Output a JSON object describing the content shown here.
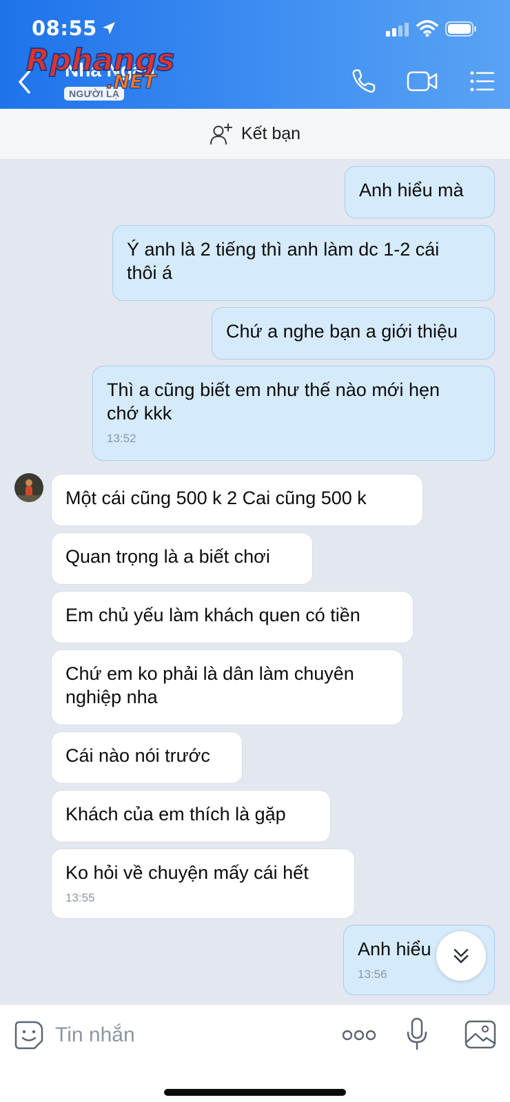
{
  "status": {
    "time": "08:55"
  },
  "header": {
    "contact_name": "Nha Ngân",
    "badge": "NGƯỜI LẠ",
    "watermark_main": "Rphangs",
    "watermark_sub": ".NET"
  },
  "friend_bar": {
    "label": "Kết bạn"
  },
  "messages": [
    {
      "dir": "out",
      "text": "Anh hiểu mà",
      "time": ""
    },
    {
      "dir": "out",
      "text": "Ý anh là 2 tiếng thì anh làm dc 1-2 cái\nthôi á",
      "time": ""
    },
    {
      "dir": "out",
      "text": "Chứ a nghe bạn a giới thiệu",
      "time": ""
    },
    {
      "dir": "out",
      "text": "Thì a cũng biết em như thế nào mới hẹn\nchớ kkk",
      "time": "13:52"
    },
    {
      "dir": "in",
      "text": "Một cái cũng 500 k 2 Cai cũng 500 k",
      "time": ""
    },
    {
      "dir": "in",
      "text": "Quan trọng là a biết chơi",
      "time": ""
    },
    {
      "dir": "in",
      "text": "Em chủ yếu làm khách quen có tiền",
      "time": ""
    },
    {
      "dir": "in",
      "text": "Chứ em ko phải là dân làm chuyên\nnghiệp nha",
      "time": ""
    },
    {
      "dir": "in",
      "text": "Cái nào nói trước",
      "time": ""
    },
    {
      "dir": "in",
      "text": "Khách của em thích là gặp",
      "time": ""
    },
    {
      "dir": "in",
      "text": "Ko hỏi về chuyện mấy cái hết",
      "time": "13:55"
    },
    {
      "dir": "out",
      "text": "Anh hiểu",
      "time": "13:56"
    }
  ],
  "composer": {
    "placeholder": "Tin nhắn"
  },
  "colors": {
    "header_start": "#1f73ea",
    "header_end": "#5aa3f4",
    "outgoing_bubble": "#d5ebfb",
    "incoming_bubble": "#ffffff",
    "chat_background": "#e2e7f0"
  },
  "icons": [
    "location-arrow-icon",
    "signal-icon",
    "wifi-icon",
    "battery-icon",
    "back-chevron-icon",
    "phone-icon",
    "video-camera-icon",
    "list-menu-icon",
    "add-friend-icon",
    "double-chevron-down-icon",
    "sticker-icon",
    "more-dots-icon",
    "microphone-icon",
    "image-icon"
  ]
}
